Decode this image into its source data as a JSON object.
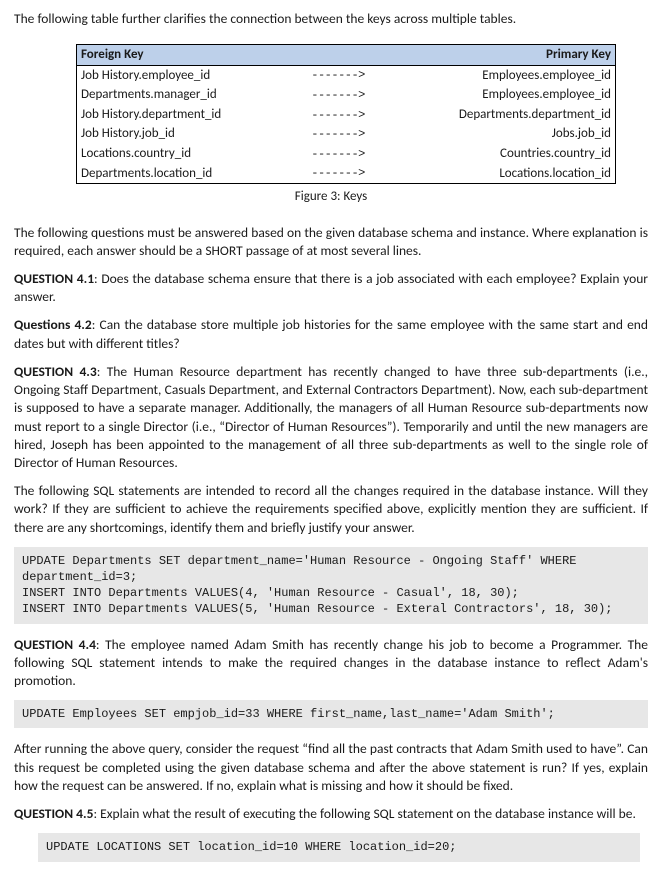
{
  "intro": "The following table further clarifies the connection between the keys across multiple tables.",
  "table": {
    "headers": {
      "left": "Foreign Key",
      "right": "Primary Key"
    },
    "arrow": "------->",
    "rows": [
      {
        "fk": "Job History.employee_id",
        "pk": "Employees.employee_id"
      },
      {
        "fk": "Departments.manager_id",
        "pk": "Employees.employee_id"
      },
      {
        "fk": "Job History.department_id",
        "pk": "Departments.department_id"
      },
      {
        "fk": "Job History.job_id",
        "pk": "Jobs.job_id"
      },
      {
        "fk": "Locations.country_id",
        "pk": "Countries.country_id"
      },
      {
        "fk": "Departments.location_id",
        "pk": "Locations.location_id"
      }
    ]
  },
  "figure_caption": "Figure 3: Keys",
  "para_instructions": "The following questions must be answered based on the given database schema and instance. Where explanation is required, each answer should be a SHORT passage of at most several lines.",
  "q41": {
    "label": "QUESTION 4.1",
    "text": ": Does the database schema ensure that there is a job associated with each employee? Explain your answer."
  },
  "q42": {
    "label": "Questions 4.2",
    "text": ": Can the database store multiple job histories for the same employee with the same start and end dates but with different titles?"
  },
  "q43": {
    "label": "QUESTION 4.3",
    "text": ": The Human Resource department has recently changed to have three sub-departments (i.e., Ongoing Staff Department, Casuals Department, and External Contractors Department). Now, each sub-department is supposed to have a separate manager. Additionally, the managers of all Human Resource sub-departments now must report to a single Director (i.e., “Director of Human Resources”). Temporarily and until the new managers are hired, Joseph has been appointed to the management of all three sub-departments as well to the single role of Director of Human Resources."
  },
  "q43_followup": "The following SQL statements are intended to record all the changes required in the database instance. Will they work? If they are sufficient to achieve the requirements specified above, explicitly mention they are sufficient. If there are any shortcomings, identify them and briefly justify your answer.",
  "code43": "UPDATE Departments SET department_name='Human Resource - Ongoing Staff' WHERE\ndepartment_id=3;\nINSERT INTO Departments VALUES(4, 'Human Resource - Casual', 18, 30);\nINSERT INTO Departments VALUES(5, 'Human Resource - Exteral Contractors', 18, 30);",
  "q44": {
    "label": "QUESTION 4.4",
    "text": ": The employee named Adam Smith has recently change his job to become a Programmer. The following SQL statement intends to make the required changes in the database instance to reflect Adam's promotion."
  },
  "code44": "UPDATE Employees SET empjob_id=33 WHERE first_name,last_name='Adam Smith';",
  "q44_followup": "After running the above query, consider the request “find all the past contracts that Adam Smith used to have”. Can this request be completed using the given database schema and after the above statement is run? If yes, explain how the request can be answered. If no, explain what is missing and how it should be fixed.",
  "q45": {
    "label": "QUESTION 4.5",
    "text": ": Explain what the result of executing the following SQL statement on the database instance will be."
  },
  "code45": "UPDATE LOCATIONS SET location_id=10 WHERE location_id=20;"
}
